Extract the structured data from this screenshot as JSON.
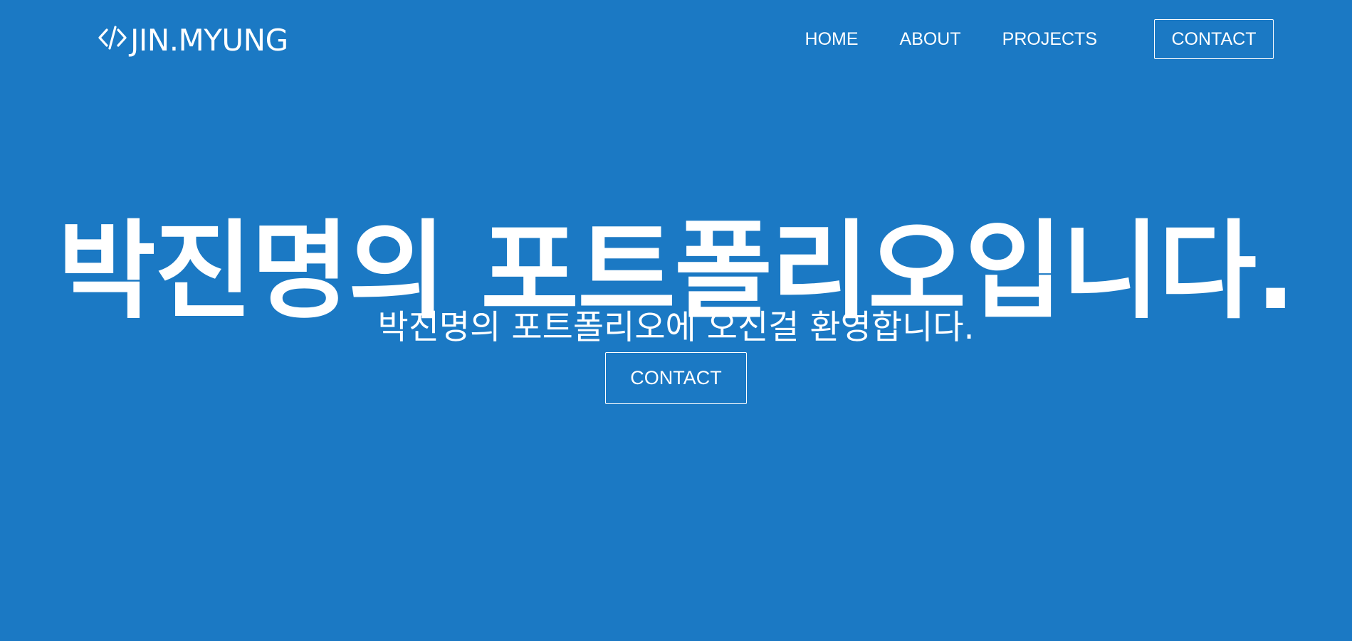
{
  "header": {
    "logo_text": "JIN.MYUNG",
    "logo_icon": "code-brackets-icon",
    "nav": {
      "home": "HOME",
      "about": "ABOUT",
      "projects": "PROJECTS",
      "contact": "CONTACT"
    }
  },
  "hero": {
    "title": "박진명의 포트폴리오입니다.",
    "subtitle": "박진명의 포트폴리오에 오신걸 환영합니다.",
    "button_label": "CONTACT"
  },
  "colors": {
    "background": "#1b79c4",
    "text": "#ffffff"
  }
}
